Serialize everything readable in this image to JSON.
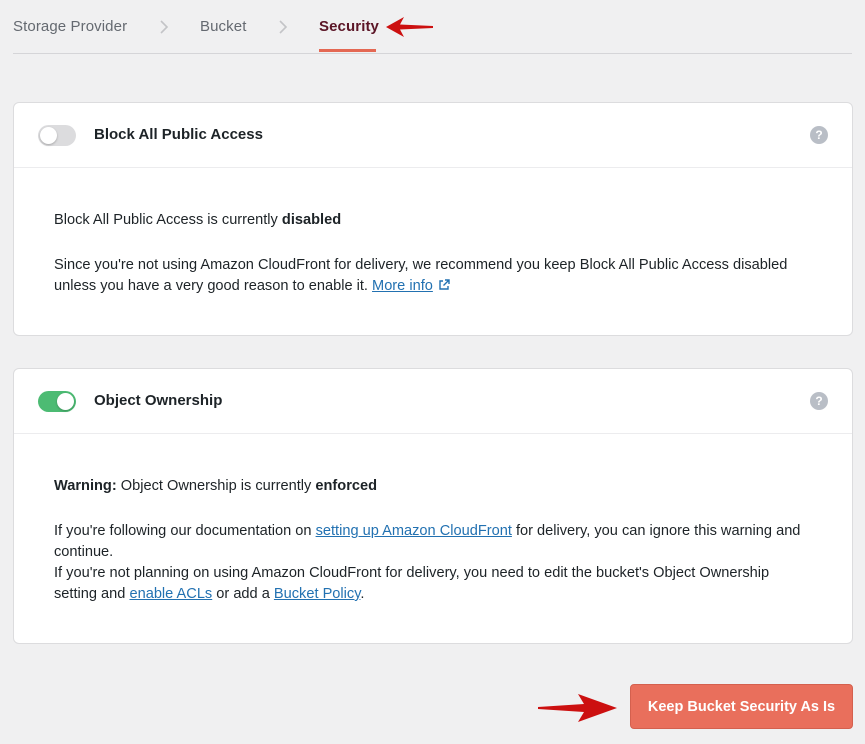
{
  "steps": {
    "items": [
      {
        "label": "Storage Provider"
      },
      {
        "label": "Bucket"
      },
      {
        "label": "Security"
      }
    ]
  },
  "panels": {
    "public_access": {
      "title": "Block All Public Access",
      "toggle_on": false,
      "status_text": "Block All Public Access is currently ",
      "status_value": "disabled",
      "desc": "Since you're not using Amazon CloudFront for delivery, we recommend you keep Block All Public Access disabled unless you have a very good reason to enable it. ",
      "more_info_link": "More info"
    },
    "ownership": {
      "title": "Object Ownership",
      "toggle_on": true,
      "warning_label": "Warning:",
      "status_text": " Object Ownership is currently ",
      "status_value": "enforced",
      "line1_pre": "If you're following our documentation on ",
      "line1_link": "setting up Amazon CloudFront",
      "line1_post": " for delivery, you can ignore this warning and continue.",
      "line2_pre": "If you're not planning on using Amazon CloudFront for delivery, you need to edit the bucket's Object Ownership setting and ",
      "line2_link1": "enable ACLs",
      "line2_mid": " or add a ",
      "line2_link2": "Bucket Policy",
      "line2_post": "."
    }
  },
  "help_glyph": "?",
  "actions": {
    "keep_label": "Keep Bucket Security As Is"
  },
  "colors": {
    "accent": "#e96f5c",
    "toggle_on": "#4cbb73",
    "link": "#2271b1",
    "annotation_arrow": "#cc1010"
  }
}
